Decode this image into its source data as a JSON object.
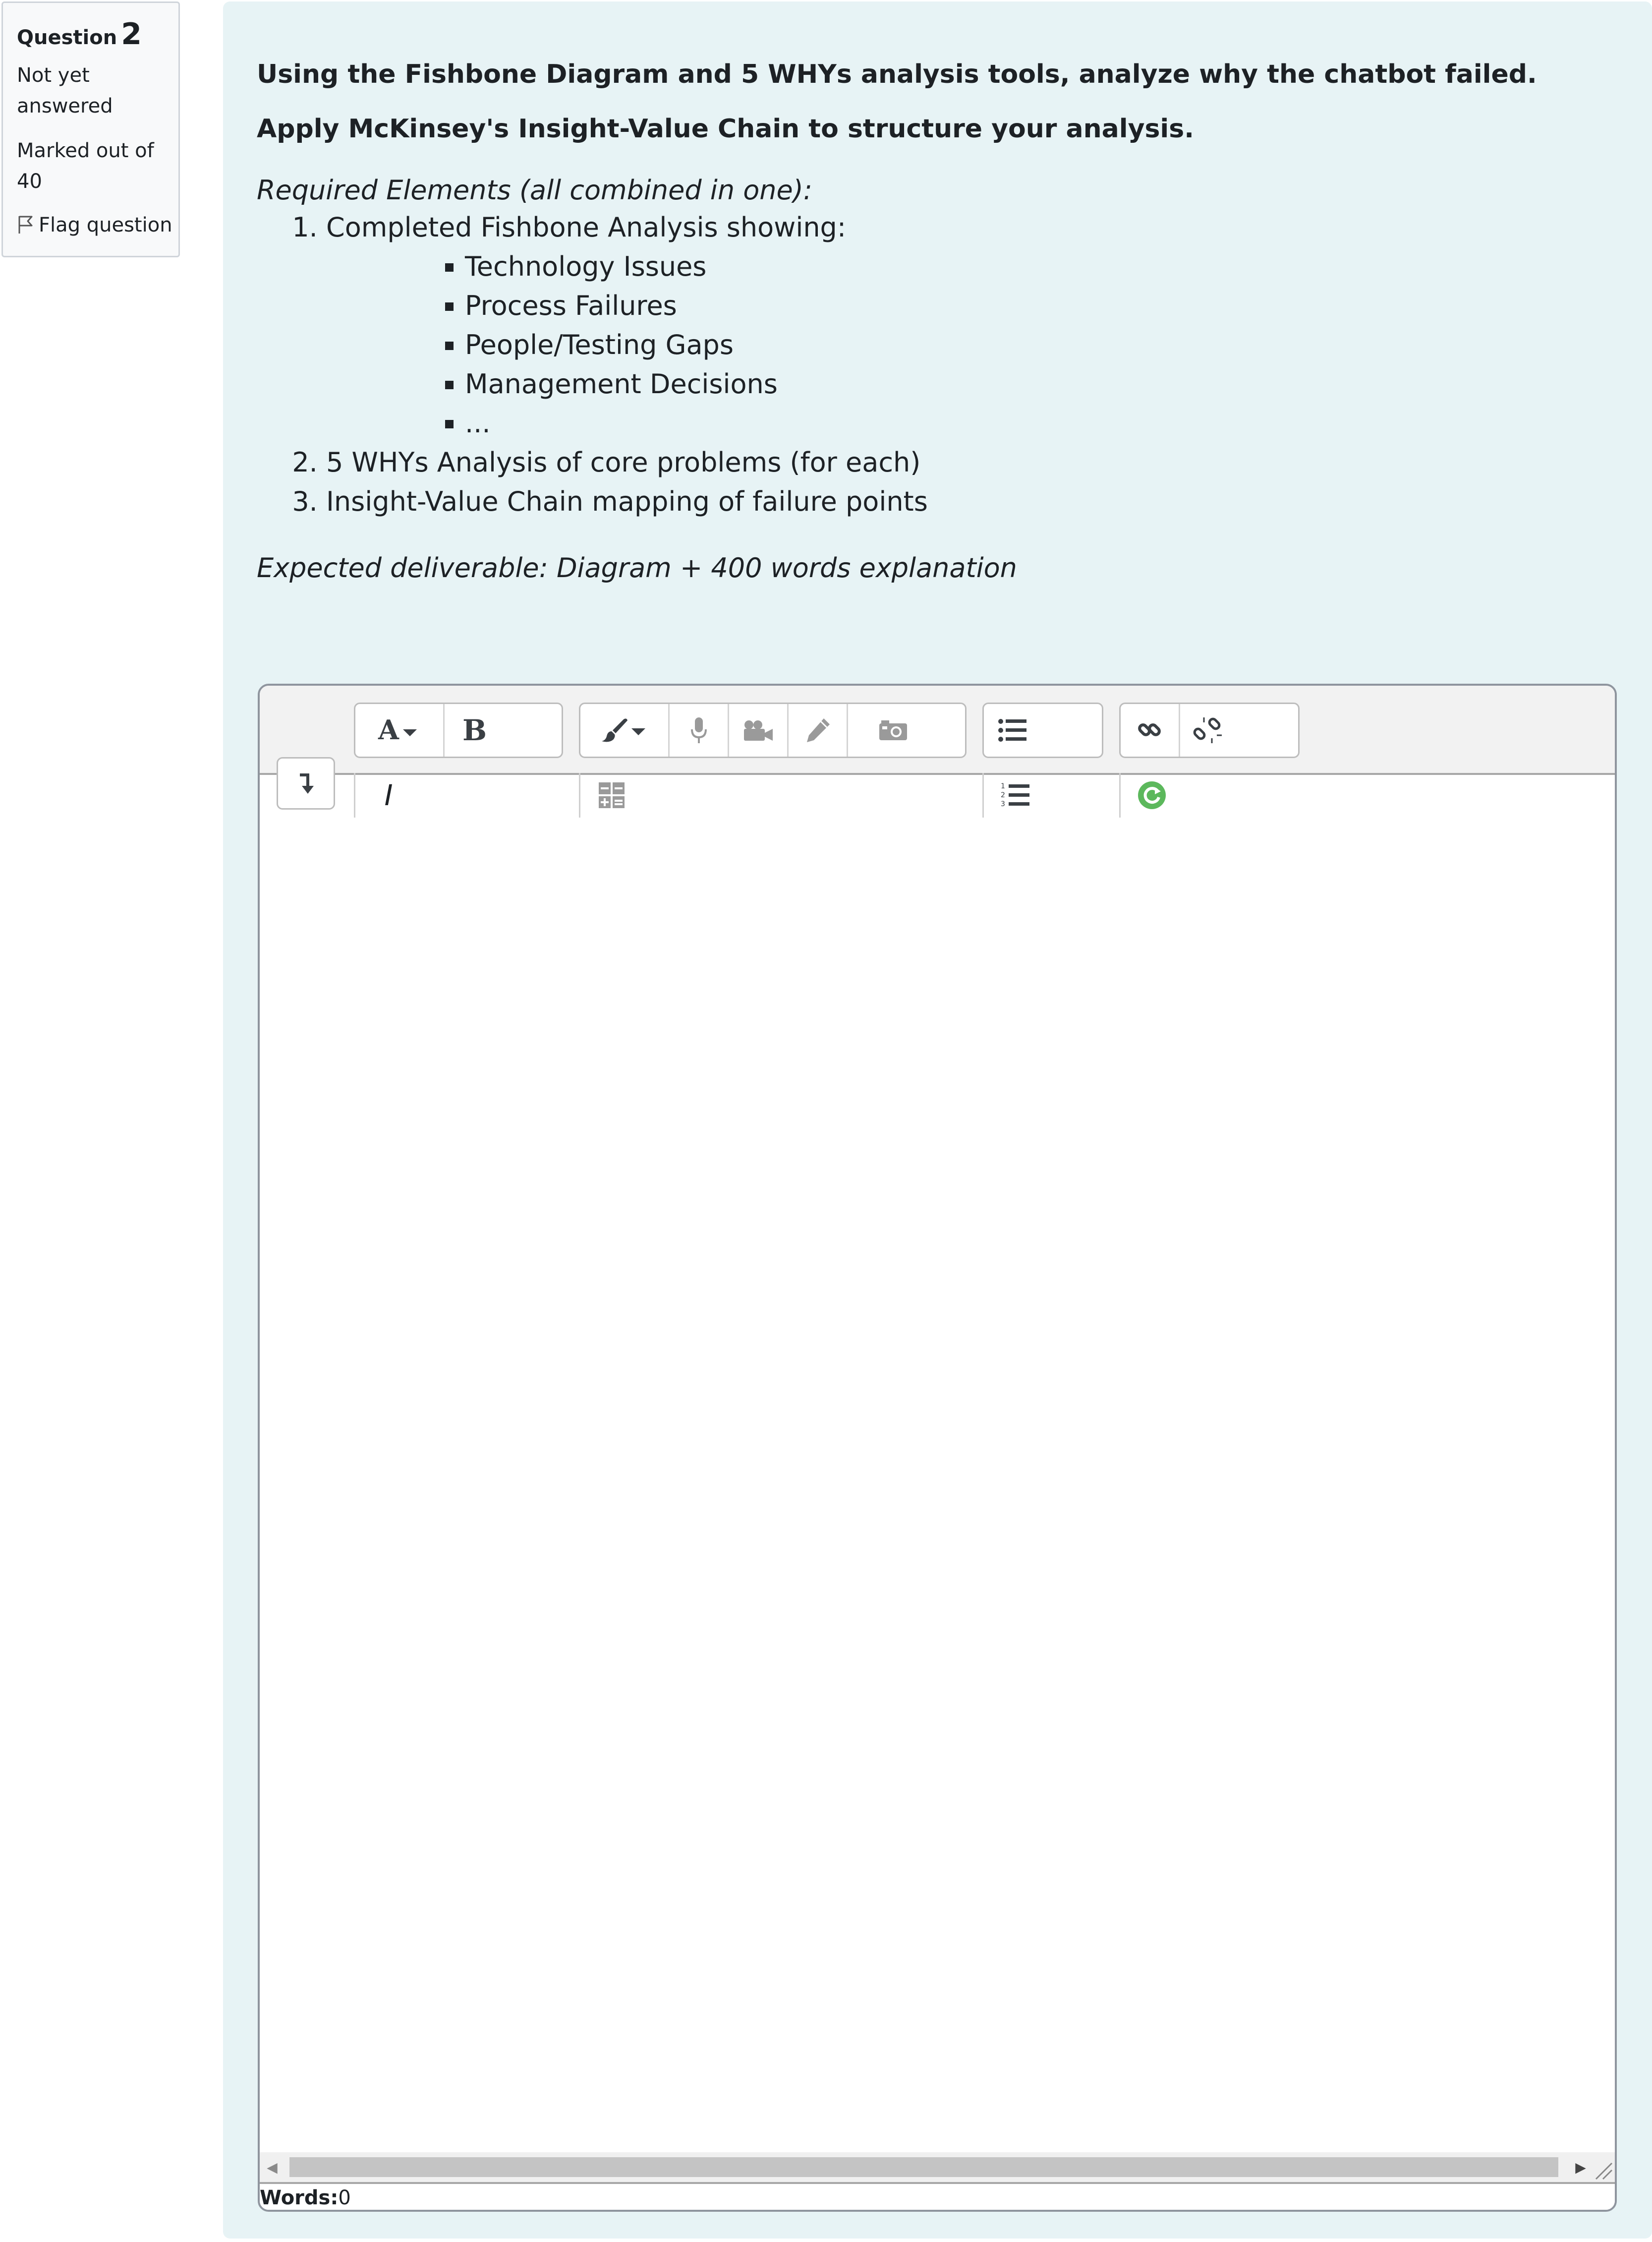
{
  "info": {
    "question_label": "Question",
    "question_number": "2",
    "state": "Not yet answered",
    "grade": "Marked out of 40",
    "flag_label": "Flag question"
  },
  "question": {
    "lead": "Using the Fishbone Diagram and 5 WHYs analysis tools, analyze why the chatbot failed. Apply McKinsey's Insight-Value Chain to structure your analysis.",
    "required_heading": "Required Elements (all combined in one):",
    "items": [
      {
        "text": "Completed Fishbone Analysis showing:",
        "subitems": [
          "Technology Issues",
          "Process Failures",
          "People/Testing Gaps",
          "Management Decisions",
          "..."
        ]
      },
      {
        "text": "5 WHYs Analysis of core problems (for each)"
      },
      {
        "text": "Insight-Value Chain mapping of failure points"
      }
    ],
    "deliverable": "Expected deliverable: Diagram + 400 words explanation"
  },
  "editor": {
    "toolbar": {
      "paragraph_icon": "font-style-dropdown-icon",
      "bold_label": "B",
      "italic_label": "I",
      "text_color_icon": "paintbrush-dropdown-icon",
      "record_audio_icon": "microphone-icon",
      "record_video_icon": "video-camera-icon",
      "draw_icon": "pencil-icon",
      "image_icon": "camera-icon",
      "unordered_list_icon": "bulleted-list-icon",
      "ordered_list_icon": "numbered-list-icon",
      "link_icon": "link-icon",
      "unlink_icon": "unlink-icon",
      "equation_icon": "equation-editor-icon",
      "autosave_icon": "sync-icon",
      "expand_icon": "expand-toolbar-icon"
    },
    "content": "",
    "word_count_label": "Words:",
    "word_count": "0"
  },
  "colors": {
    "panel_bg": "#e7f3f5",
    "info_bg": "#f8f9fa",
    "sync_green": "#5cb85c"
  }
}
